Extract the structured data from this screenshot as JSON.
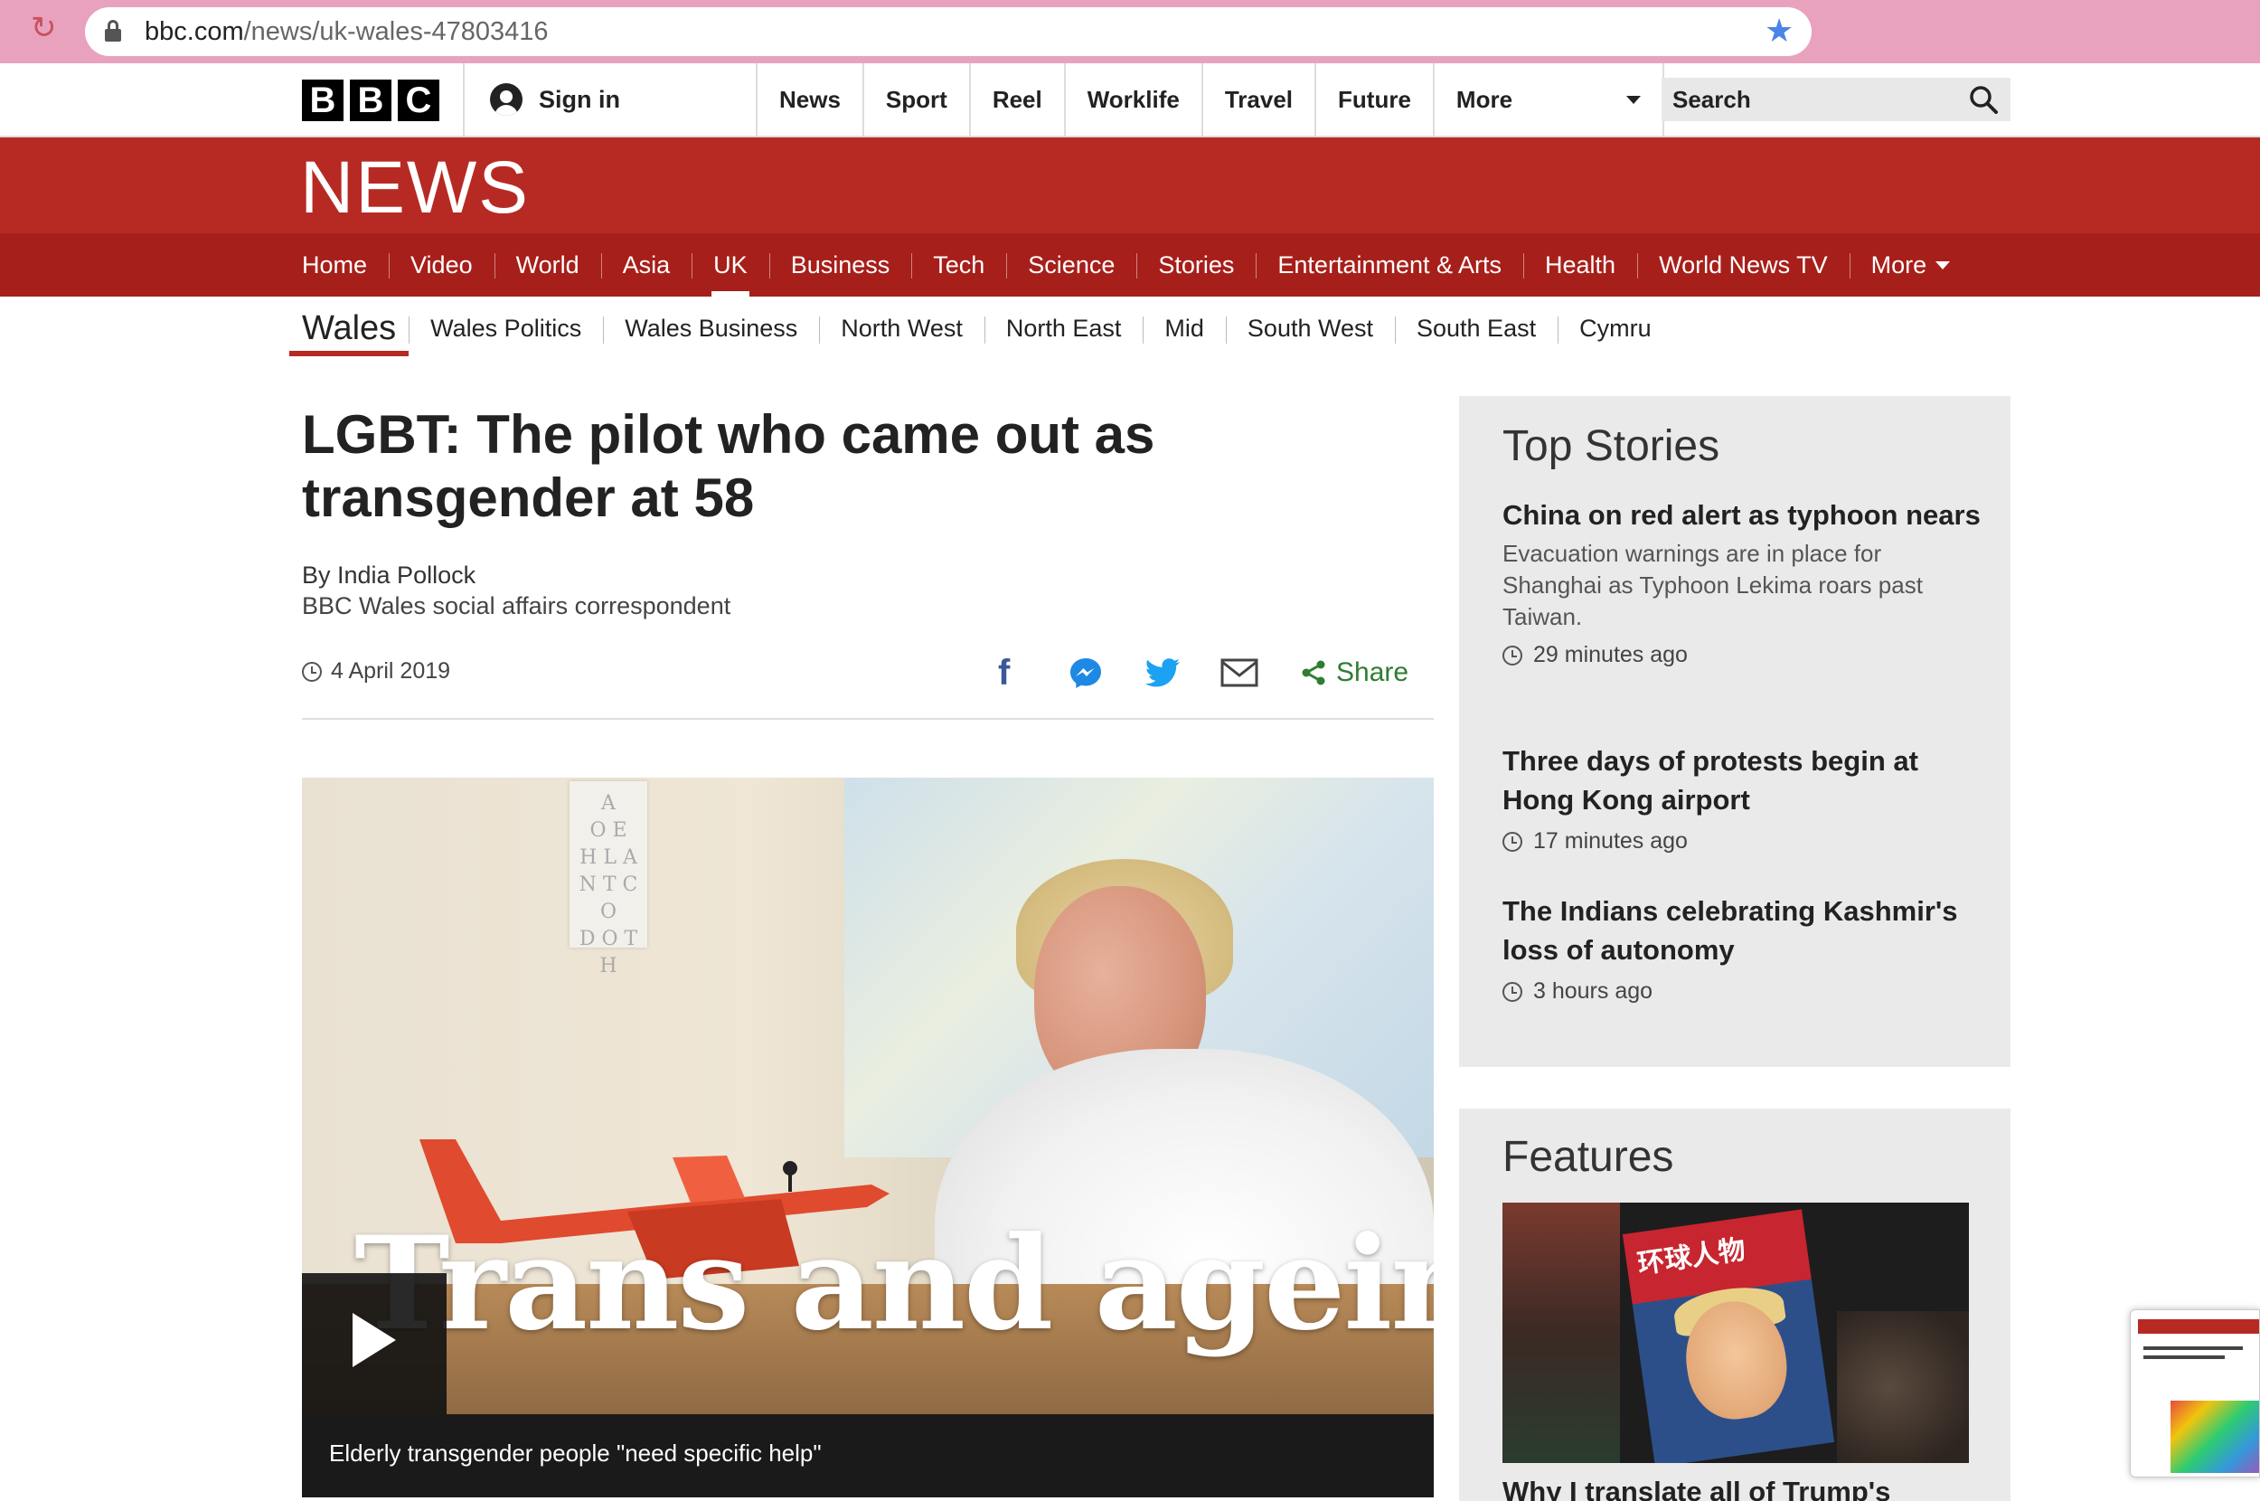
{
  "browser": {
    "url_domain": "bbc.com",
    "url_path": "/news/uk-wales-47803416"
  },
  "bbc_bar": {
    "logo_letters": [
      "B",
      "B",
      "C"
    ],
    "sign_in": "Sign in",
    "nav": [
      "News",
      "Sport",
      "Reel",
      "Worklife",
      "Travel",
      "Future"
    ],
    "more": "More",
    "search_placeholder": "Search"
  },
  "news_banner": {
    "title": "NEWS",
    "nav": [
      "Home",
      "Video",
      "World",
      "Asia",
      "UK",
      "Business",
      "Tech",
      "Science",
      "Stories",
      "Entertainment & Arts",
      "Health",
      "World News TV"
    ],
    "active_item": "UK",
    "more": "More"
  },
  "wales_nav": {
    "home": "Wales",
    "items": [
      "Wales Politics",
      "Wales Business",
      "North West",
      "North East",
      "Mid",
      "South West",
      "South East",
      "Cymru"
    ]
  },
  "article": {
    "headline": "LGBT: The pilot who came out as transgender at 58",
    "byline_name": "By India Pollock",
    "byline_role": "BBC Wales social affairs correspondent",
    "date": "4 April 2019",
    "share_label": "Share",
    "media": {
      "overlay_title": "Trans and ageing",
      "caption": "Elderly transgender people \"need specific help\"",
      "eye_chart": [
        "A",
        "O E",
        "H L A",
        "N T C O",
        "D O T H"
      ]
    }
  },
  "top_stories": {
    "title": "Top Stories",
    "stories": [
      {
        "headline": "China on red alert as typhoon nears",
        "summary": "Evacuation warnings are in place for Shanghai as Typhoon Lekima roars past Taiwan.",
        "time": "29 minutes ago"
      },
      {
        "headline": "Three days of protests begin at Hong Kong airport",
        "summary": "",
        "time": "17 minutes ago"
      },
      {
        "headline": "The Indians celebrating Kashmir's loss of autonomy",
        "summary": "",
        "time": "3 hours ago"
      }
    ]
  },
  "features": {
    "title": "Features",
    "image_text": "环球人物",
    "headline": "Why I translate all of Trump's"
  },
  "colors": {
    "bbc_red": "#b72a24",
    "nav_red": "#a71f1a",
    "share_green": "#2f7d32",
    "facebook_blue": "#3b5998",
    "twitter_blue": "#1da1f2",
    "bookmark_blue": "#4a84e8"
  }
}
